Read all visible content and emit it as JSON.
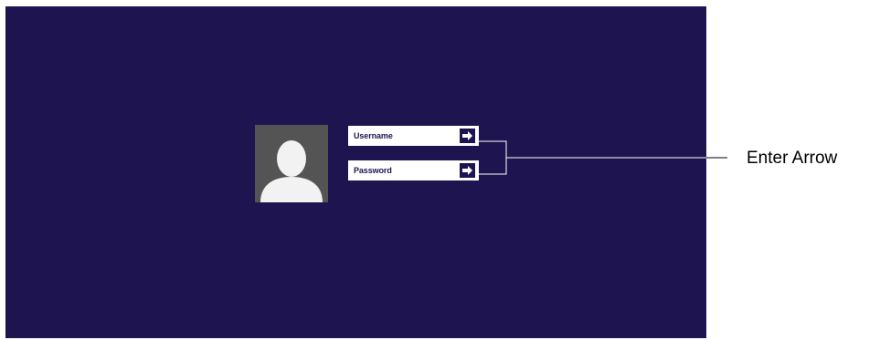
{
  "login": {
    "username_label": "Username",
    "password_label": "Password"
  },
  "annotation": {
    "label": "Enter Arrow"
  },
  "icons": {
    "avatar": "user-silhouette-icon",
    "enter": "arrow-right-icon"
  },
  "colors": {
    "background": "#1e1550",
    "avatar_bg": "#545454",
    "field_bg": "#ffffff"
  }
}
